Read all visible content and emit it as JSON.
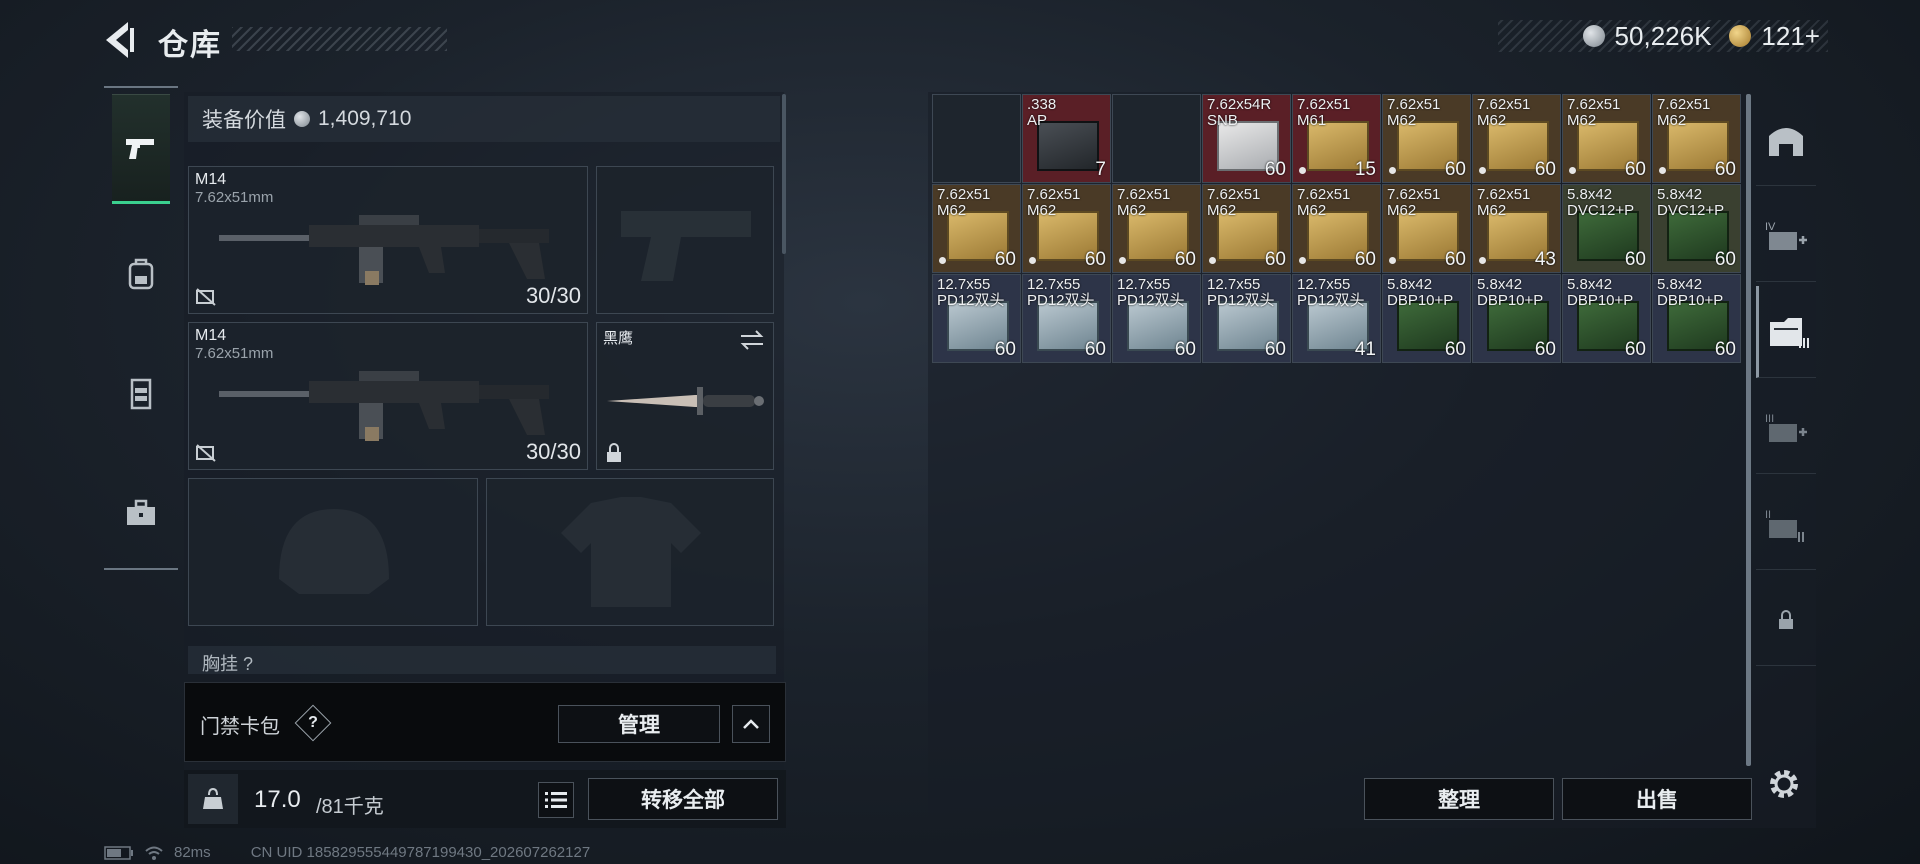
{
  "header": {
    "title": "仓库",
    "currency_silver": "50,226K",
    "currency_gold": "121+",
    "plus": "+"
  },
  "left_nav": {
    "tabs": [
      {
        "icon": "pistol-icon",
        "active": true
      },
      {
        "icon": "backpack-icon",
        "active": false
      },
      {
        "icon": "vest-icon",
        "active": false
      },
      {
        "icon": "toolbox-icon",
        "active": false
      }
    ]
  },
  "equipment": {
    "value_label": "装备价值",
    "value": "1,409,710",
    "primary1": {
      "name": "M14",
      "caliber": "7.62x51mm",
      "ammo": "30/30"
    },
    "primary2": {
      "name": "M14",
      "caliber": "7.62x51mm",
      "ammo": "30/30"
    },
    "melee": {
      "name": "黑鹰"
    },
    "chest_label": "胸挂 ?"
  },
  "keycard": {
    "label": "门禁卡包",
    "help": "?",
    "manage": "管理"
  },
  "weight": {
    "current": "17.0",
    "max": "/81千克",
    "transfer_all": "转移全部"
  },
  "status": {
    "ping": "82ms",
    "uid": "CN UID 185829555449787199430_202607262127"
  },
  "stash": {
    "rows": [
      [
        {
          "label": "",
          "count": "",
          "bg": "#1e252d"
        },
        {
          "label": ".338\nAP",
          "count": "7",
          "bg": "#5a1f26",
          "box": "dark"
        },
        {
          "label": "",
          "count": "",
          "bg": "#1e252d"
        },
        {
          "label": "7.62x54R\nSNB",
          "count": "60",
          "bg": "#5a1f26",
          "box": "white"
        },
        {
          "label": "7.62x51\nM61",
          "count": "15",
          "bg": "#5a1f26",
          "box": "gold",
          "dot": true
        },
        {
          "label": "7.62x51\nM62",
          "count": "60",
          "bg": "#4a3a26",
          "box": "gold",
          "dot": true
        },
        {
          "label": "7.62x51\nM62",
          "count": "60",
          "bg": "#4a3a26",
          "box": "gold",
          "dot": true
        },
        {
          "label": "7.62x51\nM62",
          "count": "60",
          "bg": "#4a3a26",
          "box": "gold",
          "dot": true
        },
        {
          "label": "7.62x51\nM62",
          "count": "60",
          "bg": "#4a3a26",
          "box": "gold",
          "dot": true
        }
      ],
      [
        {
          "label": "7.62x51\nM62",
          "count": "60",
          "bg": "#4a3a26",
          "box": "gold",
          "dot": true
        },
        {
          "label": "7.62x51\nM62",
          "count": "60",
          "bg": "#4a3a26",
          "box": "gold",
          "dot": true
        },
        {
          "label": "7.62x51\nM62",
          "count": "60",
          "bg": "#4a3a26",
          "box": "gold",
          "dot": true
        },
        {
          "label": "7.62x51\nM62",
          "count": "60",
          "bg": "#4a3a26",
          "box": "gold",
          "dot": true
        },
        {
          "label": "7.62x51\nM62",
          "count": "60",
          "bg": "#4a3a26",
          "box": "gold",
          "dot": true
        },
        {
          "label": "7.62x51\nM62",
          "count": "60",
          "bg": "#4a3a26",
          "box": "gold",
          "dot": true
        },
        {
          "label": "7.62x51\nM62",
          "count": "43",
          "bg": "#4a3a26",
          "box": "gold",
          "dot": true
        },
        {
          "label": "5.8x42\nDVC12+P",
          "count": "60",
          "bg": "#3a4030",
          "box": "green"
        },
        {
          "label": "5.8x42\nDVC12+P",
          "count": "60",
          "bg": "#3a4030",
          "box": "green"
        }
      ],
      [
        {
          "label": "12.7x55\nPD12双头",
          "count": "60",
          "bg": "#2d3448",
          "box": "blue"
        },
        {
          "label": "12.7x55\nPD12双头",
          "count": "60",
          "bg": "#2d3448",
          "box": "blue"
        },
        {
          "label": "12.7x55\nPD12双头",
          "count": "60",
          "bg": "#2d3448",
          "box": "blue"
        },
        {
          "label": "12.7x55\nPD12双头",
          "count": "60",
          "bg": "#2d3448",
          "box": "blue"
        },
        {
          "label": "12.7x55\nPD12双头",
          "count": "41",
          "bg": "#2d3448",
          "box": "blue"
        },
        {
          "label": "5.8x42\nDBP10+P",
          "count": "60",
          "bg": "#2d3448",
          "box": "green"
        },
        {
          "label": "5.8x42\nDBP10+P",
          "count": "60",
          "bg": "#2d3448",
          "box": "green"
        },
        {
          "label": "5.8x42\nDBP10+P",
          "count": "60",
          "bg": "#2d3448",
          "box": "green"
        },
        {
          "label": "5.8x42\nDBP10+P",
          "count": "60",
          "bg": "#2d3448",
          "box": "green"
        }
      ]
    ],
    "sort_label": "整理",
    "sell_label": "出售"
  },
  "right_nav": {
    "items": [
      {
        "icon": "home-storage-icon"
      },
      {
        "icon": "storage-iv-plus-icon",
        "tier": "IV"
      },
      {
        "icon": "storage-case-icon"
      },
      {
        "icon": "storage-iii-icon",
        "tier": "III"
      },
      {
        "icon": "storage-ii-icon",
        "tier": "II"
      },
      {
        "icon": "lock-icon"
      }
    ]
  },
  "colors": {
    "accent_green": "#3bd08f",
    "red_slot": "#5a1f26",
    "gold_slot": "#4a3a26",
    "blue_slot": "#2d3448"
  }
}
